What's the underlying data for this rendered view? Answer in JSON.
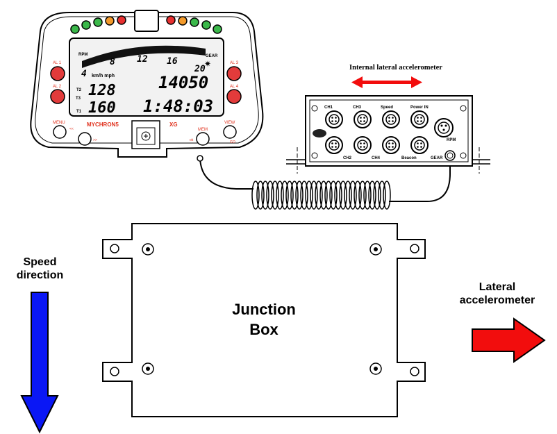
{
  "dashboard": {
    "rpm_scale": [
      "4",
      "8",
      "12",
      "16",
      "20"
    ],
    "rpm_label": "RPM",
    "units_label": "km/h mph",
    "gear_label": "GEAR",
    "t2_label": "T2",
    "t3_label": "T3",
    "t1_label": "T1",
    "rpm_value": "14050",
    "speed_value": "128",
    "t3_value": "160",
    "laptime_value": "1:48:03",
    "brand": "MYCHRON5",
    "model": "XG",
    "button_labels": {
      "al1": "AL 1",
      "al2": "AL 2",
      "al3": "AL 3",
      "al4": "AL 4",
      "menu": "MENU",
      "menu_sub": "<<",
      "prev_sub": ">>",
      "mem": "MEM",
      "mem_sub": "ok",
      "view": "VIEW",
      "view_sub": "GO"
    }
  },
  "expansion": {
    "title": "Internal lateral accelerometer",
    "top_ports": [
      "CH1",
      "CH3",
      "Speed",
      "Power IN"
    ],
    "bottom_ports": [
      "CH2",
      "CH4",
      "Beacon",
      "GEAR"
    ],
    "rpm_port": "RPM"
  },
  "junction_box": {
    "label_line1": "Junction",
    "label_line2": "Box"
  },
  "speed_direction": {
    "line1": "Speed",
    "line2": "direction",
    "color": "#0a17f5"
  },
  "lateral_accel": {
    "line1": "Lateral",
    "line2": "accelerometer",
    "color": "#f20d0d"
  }
}
